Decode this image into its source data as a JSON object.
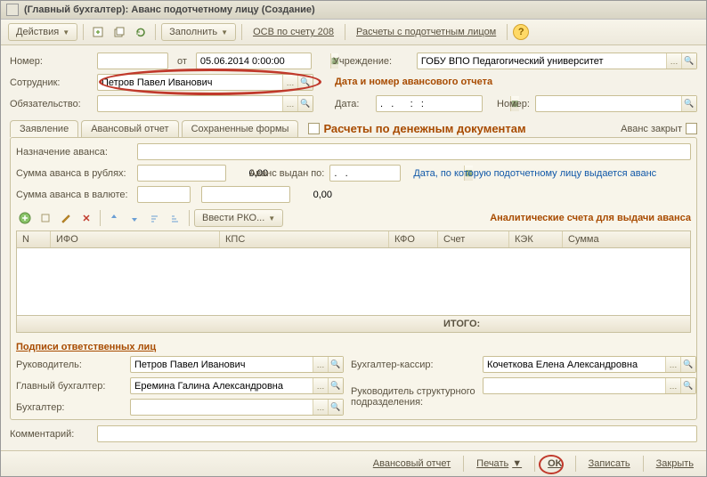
{
  "window": {
    "title": "(Главный бухгалтер): Аванс подотчетному лицу (Создание)"
  },
  "toolbar": {
    "actions": "Действия",
    "fill": "Заполнить",
    "osv": "ОСВ по счету 208",
    "calc": "Расчеты с подотчетным лицом"
  },
  "header": {
    "number_lbl": "Номер:",
    "number_val": "",
    "from_lbl": "от",
    "date_val": "05.06.2014 0:00:00",
    "org_lbl": "Учреждение:",
    "org_val": "ГОБУ ВПО Педагогический университет",
    "emp_lbl": "Сотрудник:",
    "emp_val": "Петров Павел Иванович",
    "obl_lbl": "Обязательство:",
    "obl_val": "",
    "adv_section": "Дата и номер авансового отчета",
    "date_lbl": "Дата:",
    "date2_val": ".   .      :   :",
    "num2_lbl": "Номер:",
    "num2_val": ""
  },
  "tabs": {
    "t1": "Заявление",
    "t2": "Авансовый отчет",
    "t3": "Сохраненные формы",
    "chk": "Расчеты по денежным документам",
    "closed": "Аванс закрыт"
  },
  "pane": {
    "purpose_lbl": "Назначение аванса:",
    "purpose_val": "",
    "sum_rub_lbl": "Сумма аванса в рублях:",
    "sum_rub_val": "0,00",
    "sum_val_lbl": "Сумма аванса в валюте:",
    "sum_val_val": "0,00",
    "adv_given_lbl": "Аванс выдан по:",
    "adv_given_val": ".   .",
    "adv_hint": "Дата, по которую подотчетному лицу выдается аванс",
    "enter_pko": "Ввести РКО...",
    "analytic": "Аналитические счета для выдачи аванса"
  },
  "grid": {
    "cols": {
      "n": "N",
      "ifo": "ИФО",
      "kps": "КПС",
      "kfo": "КФО",
      "acct": "Счет",
      "kek": "КЭК",
      "sum": "Сумма"
    },
    "total": "ИТОГО:"
  },
  "signatures": {
    "title": "Подписи ответственных лиц",
    "head_lbl": "Руководитель:",
    "head_val": "Петров Павел Иванович",
    "chief_lbl": "Главный бухгалтер:",
    "chief_val": "Еремина Галина Александровна",
    "acc_lbl": "Бухгалтер:",
    "acc_val": "",
    "cash_lbl": "Бухгалтер-кассир:",
    "cash_val": "Кочеткова Елена Александровна",
    "struct_lbl": "Руководитель структурного подразделения:",
    "struct_val": ""
  },
  "comment": {
    "lbl": "Комментарий:",
    "val": ""
  },
  "footer": {
    "advrep": "Авансовый отчет",
    "print": "Печать",
    "ok": "OK",
    "save": "Записать",
    "close": "Закрыть"
  }
}
